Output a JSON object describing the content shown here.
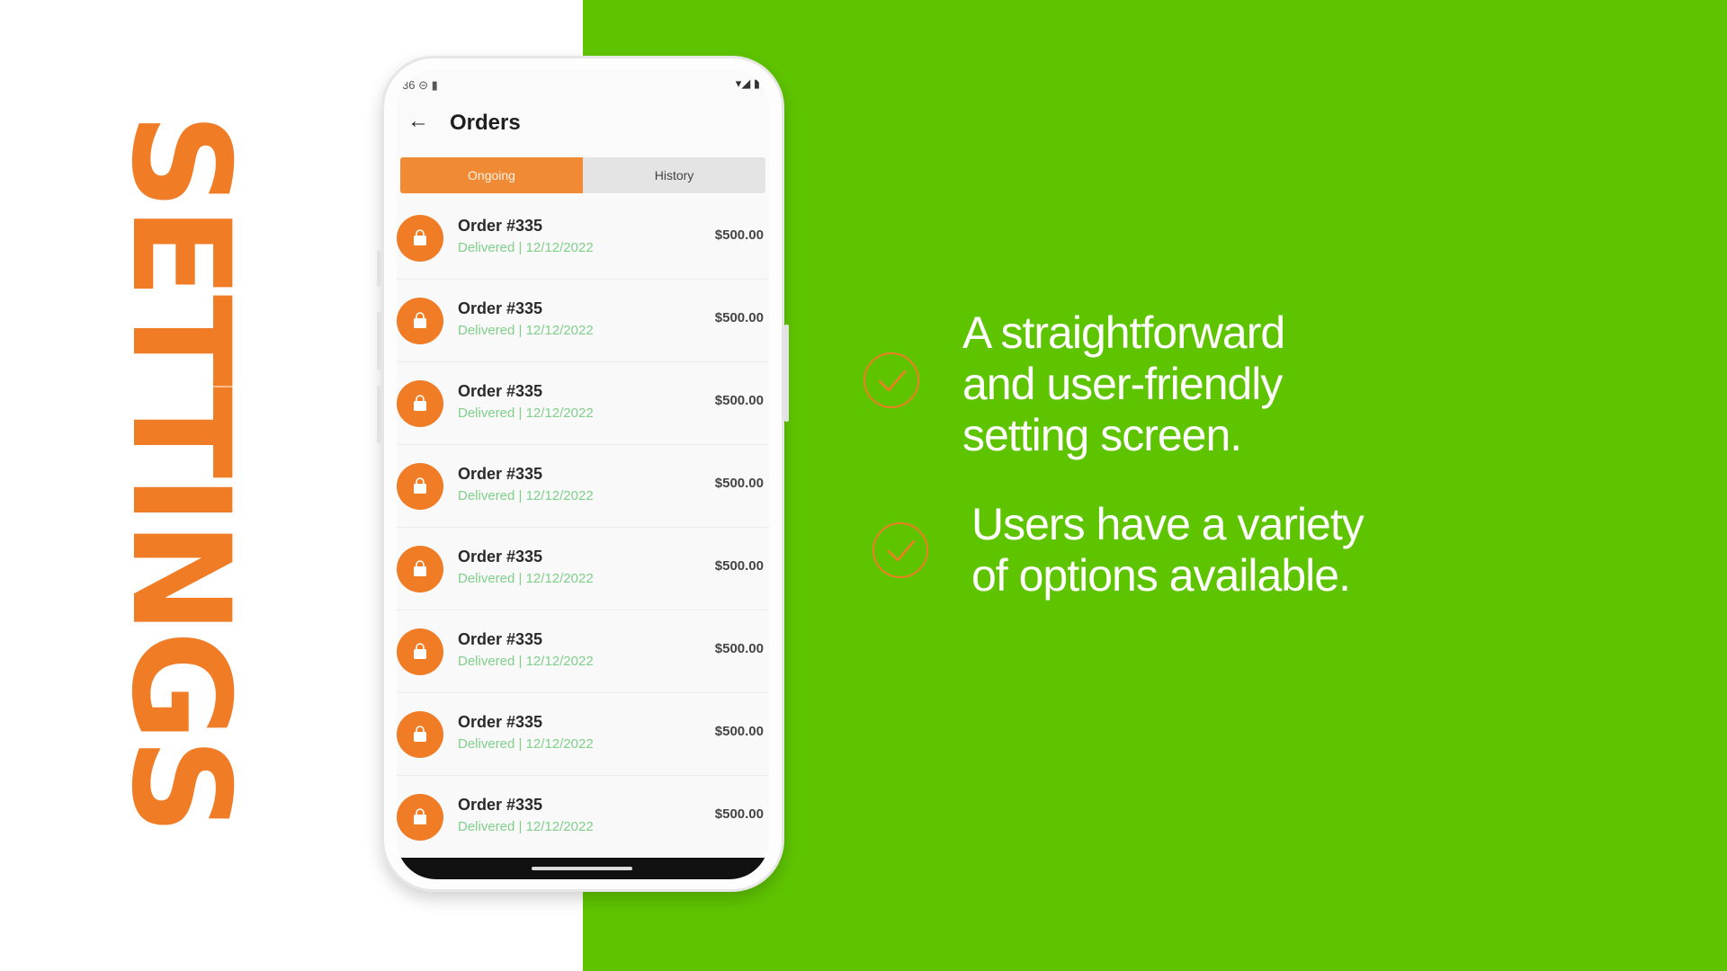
{
  "side_title": "SETTINGS",
  "phone": {
    "status_bar": {
      "left": "36 ⊝ ▮",
      "right": "▾◢ ▮"
    },
    "appbar": {
      "back_icon": "arrow-back-icon",
      "title": "Orders"
    },
    "tabs": [
      {
        "label": "Ongoing",
        "active": true
      },
      {
        "label": "History",
        "active": false
      }
    ],
    "orders": [
      {
        "title": "Order #335",
        "status": "Delivered | 12/12/2022",
        "price": "$500.00",
        "icon": "shopping-bag-icon"
      },
      {
        "title": "Order #335",
        "status": "Delivered | 12/12/2022",
        "price": "$500.00",
        "icon": "shopping-bag-icon"
      },
      {
        "title": "Order #335",
        "status": "Delivered | 12/12/2022",
        "price": "$500.00",
        "icon": "shopping-bag-icon"
      },
      {
        "title": "Order #335",
        "status": "Delivered | 12/12/2022",
        "price": "$500.00",
        "icon": "shopping-bag-icon"
      },
      {
        "title": "Order #335",
        "status": "Delivered | 12/12/2022",
        "price": "$500.00",
        "icon": "shopping-bag-icon"
      },
      {
        "title": "Order #335",
        "status": "Delivered | 12/12/2022",
        "price": "$500.00",
        "icon": "shopping-bag-icon"
      },
      {
        "title": "Order #335",
        "status": "Delivered | 12/12/2022",
        "price": "$500.00",
        "icon": "shopping-bag-icon"
      },
      {
        "title": "Order #335",
        "status": "Delivered | 12/12/2022",
        "price": "$500.00",
        "icon": "shopping-bag-icon"
      }
    ]
  },
  "features": [
    {
      "icon": "check-circle-icon",
      "text": "A straightforward\nand user-friendly\nsetting screen."
    },
    {
      "icon": "check-circle-icon",
      "text": "Users have a variety\nof options available."
    }
  ],
  "colors": {
    "accent": "#f07c26",
    "background_green": "#5fc400",
    "status_green": "#7fd08a"
  }
}
